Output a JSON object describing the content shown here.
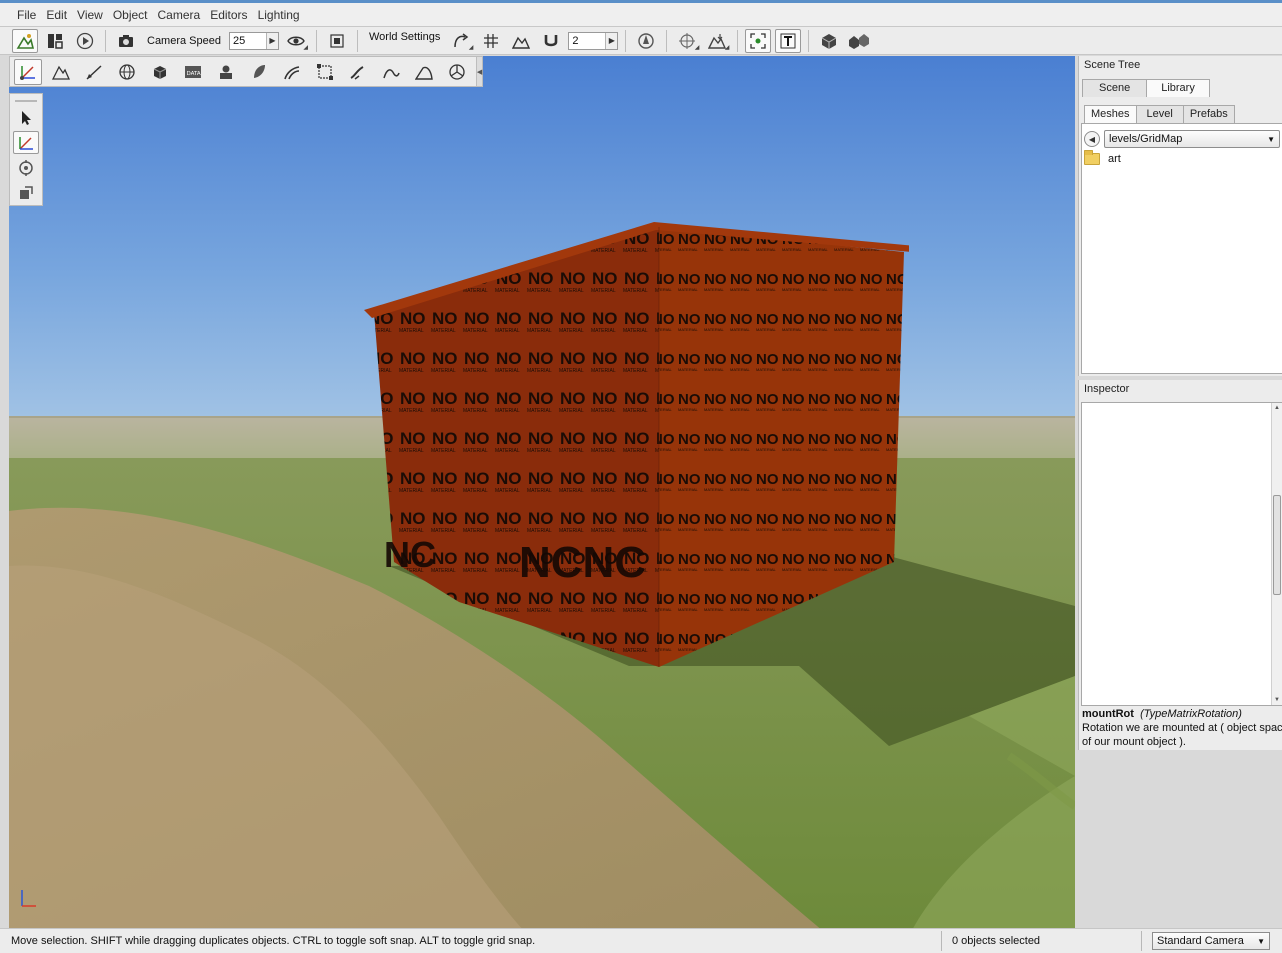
{
  "menu": {
    "items": [
      "File",
      "Edit",
      "View",
      "Object",
      "Camera",
      "Editors",
      "Lighting"
    ]
  },
  "toolbar": {
    "camera_speed_label": "Camera Speed",
    "camera_speed_value": "25",
    "world_settings_label": "World Settings",
    "grid_value": "2"
  },
  "scene_panel": {
    "title": "Scene Tree",
    "tabs": [
      "Scene",
      "Library"
    ],
    "active_tab": "Library",
    "subtabs": [
      "Meshes",
      "Level",
      "Prefabs"
    ],
    "active_subtab": "Meshes",
    "path": "levels/GridMap",
    "folders": [
      "art"
    ]
  },
  "inspector": {
    "title": "Inspector",
    "field_name": "mountRot",
    "field_type": "(TypeMatrixRotation)",
    "description_line1": "Rotation we are mounted at ( object space",
    "description_line2": "of our mount object )."
  },
  "status": {
    "message": "Move selection.  SHIFT while dragging duplicates objects.  CTRL to toggle soft snap.  ALT to toggle grid snap.",
    "selection_count": "0 objects selected",
    "camera_mode": "Standard Camera"
  },
  "scene": {
    "wall_text": "NO",
    "wall_subtext": "MATERIAL",
    "wall_color": "#8a2c0b",
    "sky_top": "#4a7fd2",
    "grass_color": "#6d8a3a"
  }
}
